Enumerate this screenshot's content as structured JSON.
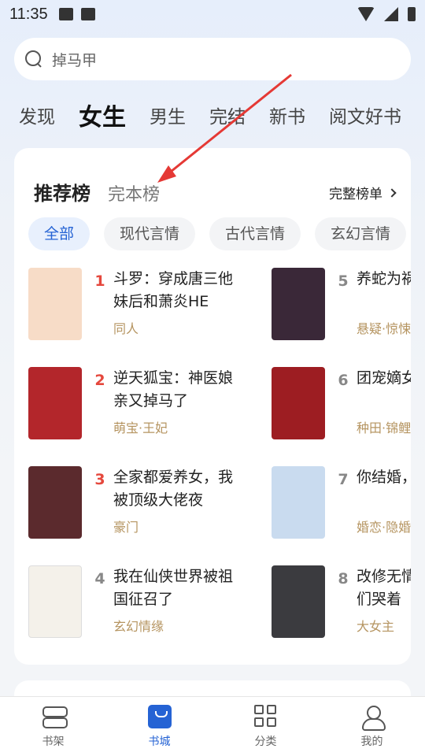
{
  "status": {
    "time": "11:35"
  },
  "search": {
    "placeholder": "掉马甲"
  },
  "tabs": [
    "发现",
    "女生",
    "男生",
    "完结",
    "新书",
    "阅文好书"
  ],
  "ranking": {
    "active_tab": "推荐榜",
    "second_tab": "完本榜",
    "full_list": "完整榜单"
  },
  "chips": [
    "全部",
    "现代言情",
    "古代言情",
    "玄幻言情"
  ],
  "books": [
    {
      "rank": "1",
      "title": "斗罗：穿成唐三他妹后和萧炎HE",
      "tag": "同人",
      "cover_color": "#f7dcc7"
    },
    {
      "rank": "2",
      "title": "逆天狐宝：神医娘亲又掉马了",
      "tag": "萌宝·王妃",
      "cover_color": "#b3262b"
    },
    {
      "rank": "3",
      "title": "全家都爱养女，我被顶级大佬夜",
      "tag": "豪门",
      "cover_color": "#5b2a2d"
    },
    {
      "rank": "4",
      "title": "我在仙侠世界被祖国征召了",
      "tag": "玄幻情缘",
      "cover_color": "#f4f1ea"
    },
    {
      "rank": "5",
      "title": "养蛇为祸",
      "tag": "悬疑·惊悚",
      "cover_color": "#3a2838"
    },
    {
      "rank": "6",
      "title": "团宠嫡女好运满满",
      "tag": "种田·锦鲤",
      "cover_color": "#9d1d22"
    },
    {
      "rank": "7",
      "title": "你结婚，我劫婚",
      "tag": "婚恋·隐婚",
      "cover_color": "#c9dbef"
    },
    {
      "rank": "8",
      "title": "改修无情道后师兄们哭着",
      "tag": "大女主",
      "cover_color": "#3b3b3f"
    }
  ],
  "nav": [
    {
      "label": "书架",
      "icon": "bookshelf-icon"
    },
    {
      "label": "书城",
      "icon": "bookstore-icon"
    },
    {
      "label": "分类",
      "icon": "category-grid-icon"
    },
    {
      "label": "我的",
      "icon": "profile-icon"
    }
  ],
  "colors": {
    "accent": "#2563d4",
    "hot_rank": "#e5483d",
    "tag": "#b59460",
    "annotation_arrow": "#e53935"
  }
}
